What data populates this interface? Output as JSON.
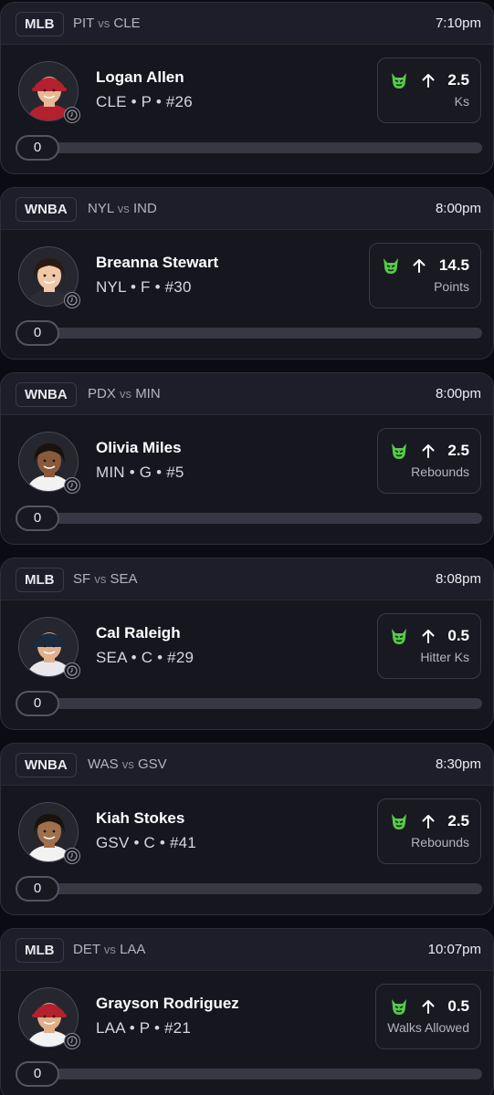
{
  "picks": [
    {
      "league": "MLB",
      "matchup": {
        "away": "PIT",
        "vs": "vs",
        "home": "CLE"
      },
      "time": "7:10pm",
      "player": {
        "name": "Logan Allen",
        "team": "CLE",
        "position": "P",
        "number": "#26"
      },
      "projection": {
        "direction": "up",
        "value": "2.5",
        "stat": "Ks"
      },
      "progress": "0",
      "avatar": {
        "skin": "#e8b894",
        "hair": "#3b2416",
        "shirt": "#b3202e",
        "cap": "#b3202e"
      }
    },
    {
      "league": "WNBA",
      "matchup": {
        "away": "NYL",
        "vs": "vs",
        "home": "IND"
      },
      "time": "8:00pm",
      "player": {
        "name": "Breanna Stewart",
        "team": "NYL",
        "position": "F",
        "number": "#30"
      },
      "projection": {
        "direction": "up",
        "value": "14.5",
        "stat": "Points"
      },
      "progress": "0",
      "avatar": {
        "skin": "#f0c8a8",
        "hair": "#2a1a12",
        "shirt": "#2c2c34",
        "cap": ""
      }
    },
    {
      "league": "WNBA",
      "matchup": {
        "away": "PDX",
        "vs": "vs",
        "home": "MIN"
      },
      "time": "8:00pm",
      "player": {
        "name": "Olivia Miles",
        "team": "MIN",
        "position": "G",
        "number": "#5"
      },
      "projection": {
        "direction": "up",
        "value": "2.5",
        "stat": "Rebounds"
      },
      "progress": "0",
      "avatar": {
        "skin": "#8a5a3c",
        "hair": "#1a120c",
        "shirt": "#f2f2f2",
        "cap": ""
      }
    },
    {
      "league": "MLB",
      "matchup": {
        "away": "SF",
        "vs": "vs",
        "home": "SEA"
      },
      "time": "8:08pm",
      "player": {
        "name": "Cal Raleigh",
        "team": "SEA",
        "position": "C",
        "number": "#29"
      },
      "projection": {
        "direction": "up",
        "value": "0.5",
        "stat": "Hitter Ks"
      },
      "progress": "0",
      "avatar": {
        "skin": "#e2b08c",
        "hair": "#6a4a2e",
        "shirt": "#e8e8ec",
        "cap": "#1c2a3e"
      }
    },
    {
      "league": "WNBA",
      "matchup": {
        "away": "WAS",
        "vs": "vs",
        "home": "GSV"
      },
      "time": "8:30pm",
      "player": {
        "name": "Kiah Stokes",
        "team": "GSV",
        "position": "C",
        "number": "#41"
      },
      "projection": {
        "direction": "up",
        "value": "2.5",
        "stat": "Rebounds"
      },
      "progress": "0",
      "avatar": {
        "skin": "#a0704c",
        "hair": "#1a120c",
        "shirt": "#f2f2f2",
        "cap": ""
      }
    },
    {
      "league": "MLB",
      "matchup": {
        "away": "DET",
        "vs": "vs",
        "home": "LAA"
      },
      "time": "10:07pm",
      "player": {
        "name": "Grayson Rodriguez",
        "team": "LAA",
        "position": "P",
        "number": "#21"
      },
      "projection": {
        "direction": "up",
        "value": "0.5",
        "stat": "Walks Allowed"
      },
      "progress": "0",
      "avatar": {
        "skin": "#e0ae88",
        "hair": "#3b2416",
        "shirt": "#f2f2f2",
        "cap": "#b3202e"
      }
    }
  ],
  "colors": {
    "demon": "#57c94a",
    "card": "#16161f",
    "header": "#1e1e2a",
    "track": "#383844"
  },
  "icons": {
    "projection": "green-demon-icon",
    "direction": "arrow-up-icon",
    "badge": "player-history-icon"
  }
}
